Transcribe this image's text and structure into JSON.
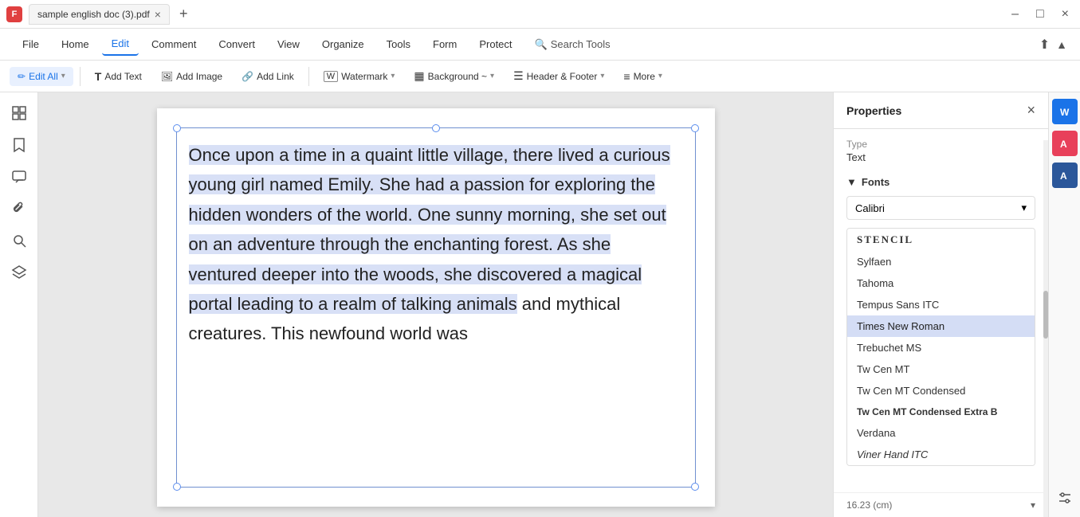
{
  "titleBar": {
    "tab": {
      "label": "sample english doc (3).pdf",
      "close": "×"
    },
    "newTab": "+",
    "winBtns": [
      "–",
      "□",
      "×"
    ]
  },
  "menuBar": {
    "items": [
      {
        "id": "file",
        "label": "File"
      },
      {
        "id": "home",
        "label": "Home"
      },
      {
        "id": "edit",
        "label": "Edit",
        "active": true
      },
      {
        "id": "comment",
        "label": "Comment"
      },
      {
        "id": "convert",
        "label": "Convert"
      },
      {
        "id": "view",
        "label": "View"
      },
      {
        "id": "organize",
        "label": "Organize"
      },
      {
        "id": "tools",
        "label": "Tools"
      },
      {
        "id": "form",
        "label": "Form"
      },
      {
        "id": "protect",
        "label": "Protect"
      },
      {
        "id": "search-tools",
        "label": "Search Tools"
      }
    ],
    "rightIcons": [
      "↑",
      "▲"
    ]
  },
  "toolbar": {
    "buttons": [
      {
        "id": "edit-all",
        "label": "Edit All",
        "icon": "✏️",
        "hasArrow": true,
        "active": true
      },
      {
        "id": "add-text",
        "label": "Add Text",
        "icon": "T"
      },
      {
        "id": "add-image",
        "label": "Add Image",
        "icon": "🖼"
      },
      {
        "id": "add-link",
        "label": "Add Link",
        "icon": "🔗"
      },
      {
        "id": "watermark",
        "label": "Watermark",
        "icon": "W",
        "hasArrow": true
      },
      {
        "id": "background",
        "label": "Background ~",
        "icon": "▦",
        "hasArrow": true
      },
      {
        "id": "header-footer",
        "label": "Header & Footer",
        "icon": "☰",
        "hasArrow": true
      },
      {
        "id": "more",
        "label": "More",
        "icon": "≡",
        "hasArrow": true
      }
    ]
  },
  "sidebar": {
    "items": [
      {
        "id": "thumbnails",
        "icon": "⊞"
      },
      {
        "id": "bookmarks",
        "icon": "🔖"
      },
      {
        "id": "comments",
        "icon": "💬"
      },
      {
        "id": "attachments",
        "icon": "📎"
      },
      {
        "id": "search",
        "icon": "🔍"
      },
      {
        "id": "layers",
        "icon": "⊗"
      }
    ]
  },
  "pdfContent": {
    "text": "Once upon a time in a quaint little village, there lived a curious young girl named Emily. She had a passion for exploring the hidden wonders of the world. One sunny morning, she set out on an adventure through the enchanting forest. As she ventured deeper into the woods, she discovered a magical portal leading to a realm of talking animals and mythical creatures. This newfound world was"
  },
  "properties": {
    "title": "Properties",
    "type": {
      "label": "Type",
      "value": "Text"
    },
    "fonts": {
      "sectionLabel": "Fonts",
      "currentFont": "Calibri",
      "fontList": [
        {
          "name": "STENCIL",
          "style": "bold"
        },
        {
          "name": "Sylfaen",
          "style": "normal"
        },
        {
          "name": "Tahoma",
          "style": "normal"
        },
        {
          "name": "Tempus Sans ITC",
          "style": "normal"
        },
        {
          "name": "Times New Roman",
          "style": "normal",
          "selected": true
        },
        {
          "name": "Trebuchet MS",
          "style": "normal"
        },
        {
          "name": "Tw Cen MT",
          "style": "normal"
        },
        {
          "name": "Tw Cen MT Condensed",
          "style": "normal"
        },
        {
          "name": "Tw Cen MT Condensed Extra B",
          "style": "bold"
        },
        {
          "name": "Verdana",
          "style": "normal"
        },
        {
          "name": "Viner Hand ITC",
          "style": "italic"
        }
      ]
    },
    "dimension": "16.23 (cm)"
  },
  "rightIcons": [
    {
      "id": "word-icon",
      "label": "W"
    },
    {
      "id": "ai-icon",
      "label": "A"
    },
    {
      "id": "ms-icon",
      "label": "A"
    }
  ]
}
